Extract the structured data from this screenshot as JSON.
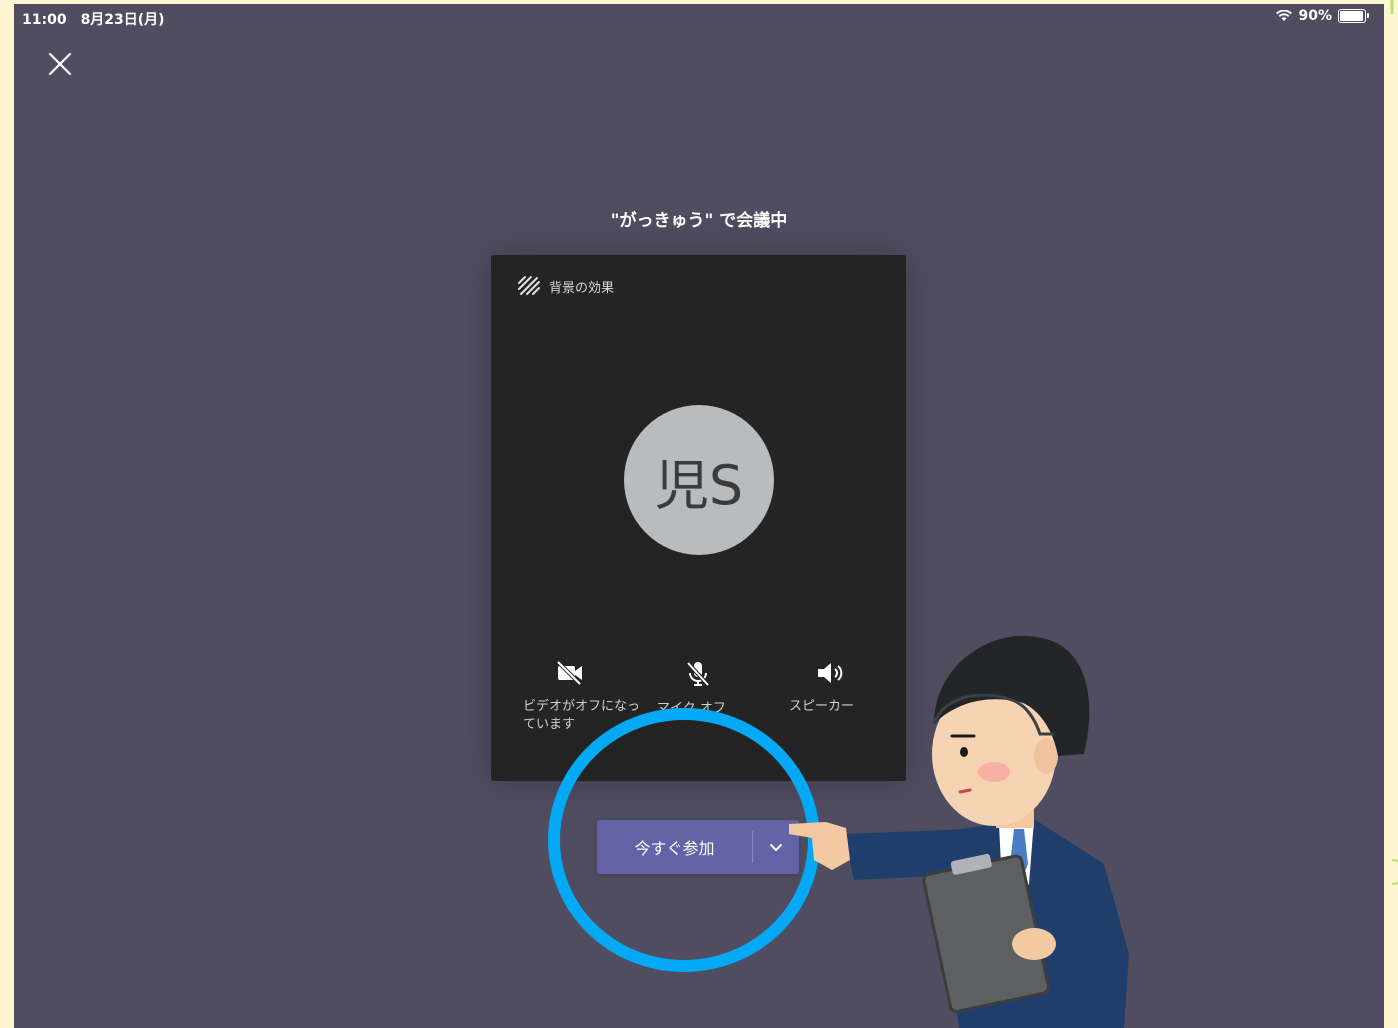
{
  "status_bar": {
    "time_date": "11:00　8月23日(月)",
    "battery": "90%",
    "battery_level": 0.9
  },
  "icons": {
    "close": "close-icon",
    "background_effects": "background-effects-icon",
    "video": "video-off-icon",
    "mic": "mic-off-icon",
    "speaker": "speaker-icon",
    "dropdown": "chevron-down-icon"
  },
  "meeting": {
    "title": "\"がっきゅう\" で会議中"
  },
  "preview": {
    "background_effects_label": "背景の効果",
    "avatar_initials": "児S",
    "controls": {
      "video_label": "ビデオがオフになっています",
      "mic_label": "マイク オフ",
      "speaker_label": "スピーカー"
    }
  },
  "join": {
    "label": "今すぐ参加"
  },
  "colors": {
    "screen_bg": "#504d61",
    "preview_bg": "#252424",
    "join_button": "#6264a7",
    "highlight_circle": "#03a9f4",
    "page_bg": "#fdf6d0"
  }
}
